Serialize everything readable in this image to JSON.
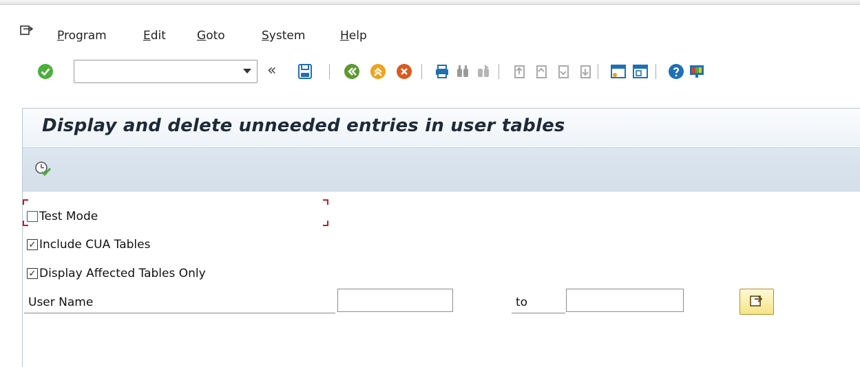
{
  "menubar": {
    "items": [
      {
        "first": "P",
        "rest": "rogram"
      },
      {
        "first": "E",
        "rest": "dit"
      },
      {
        "first": "G",
        "rest": "oto"
      },
      {
        "first": "S",
        "rest": "ystem"
      },
      {
        "first": "H",
        "rest": "elp"
      }
    ]
  },
  "toolbar": {
    "command_value": "",
    "icons": [
      "enter-icon",
      "save-icon",
      "back-icon",
      "exit-icon",
      "cancel-icon",
      "print-icon",
      "find-icon",
      "find-next-icon",
      "first-page-icon",
      "previous-page-icon",
      "next-page-icon",
      "last-page-icon",
      "create-session-icon",
      "shortcut-icon",
      "help-icon",
      "customize-layout-icon"
    ],
    "collapse_glyph": "«"
  },
  "title": "Display and delete unneeded entries in user tables",
  "app_toolbar": {
    "icons": [
      "execute-icon"
    ]
  },
  "form": {
    "test_mode": {
      "label": "Test Mode",
      "checked": false
    },
    "include_cua": {
      "label": "Include CUA Tables",
      "checked": true
    },
    "affected_only": {
      "label": "Display Affected Tables Only",
      "checked": true
    },
    "user_name": {
      "label": "User Name",
      "from": "",
      "to_label": "to",
      "to": ""
    }
  },
  "colors": {
    "accent_green": "#4caf3c",
    "title_bg": "#eef3f8",
    "app_toolbar_bg": "#d8e3ee",
    "required_marker": "#d0141e"
  }
}
